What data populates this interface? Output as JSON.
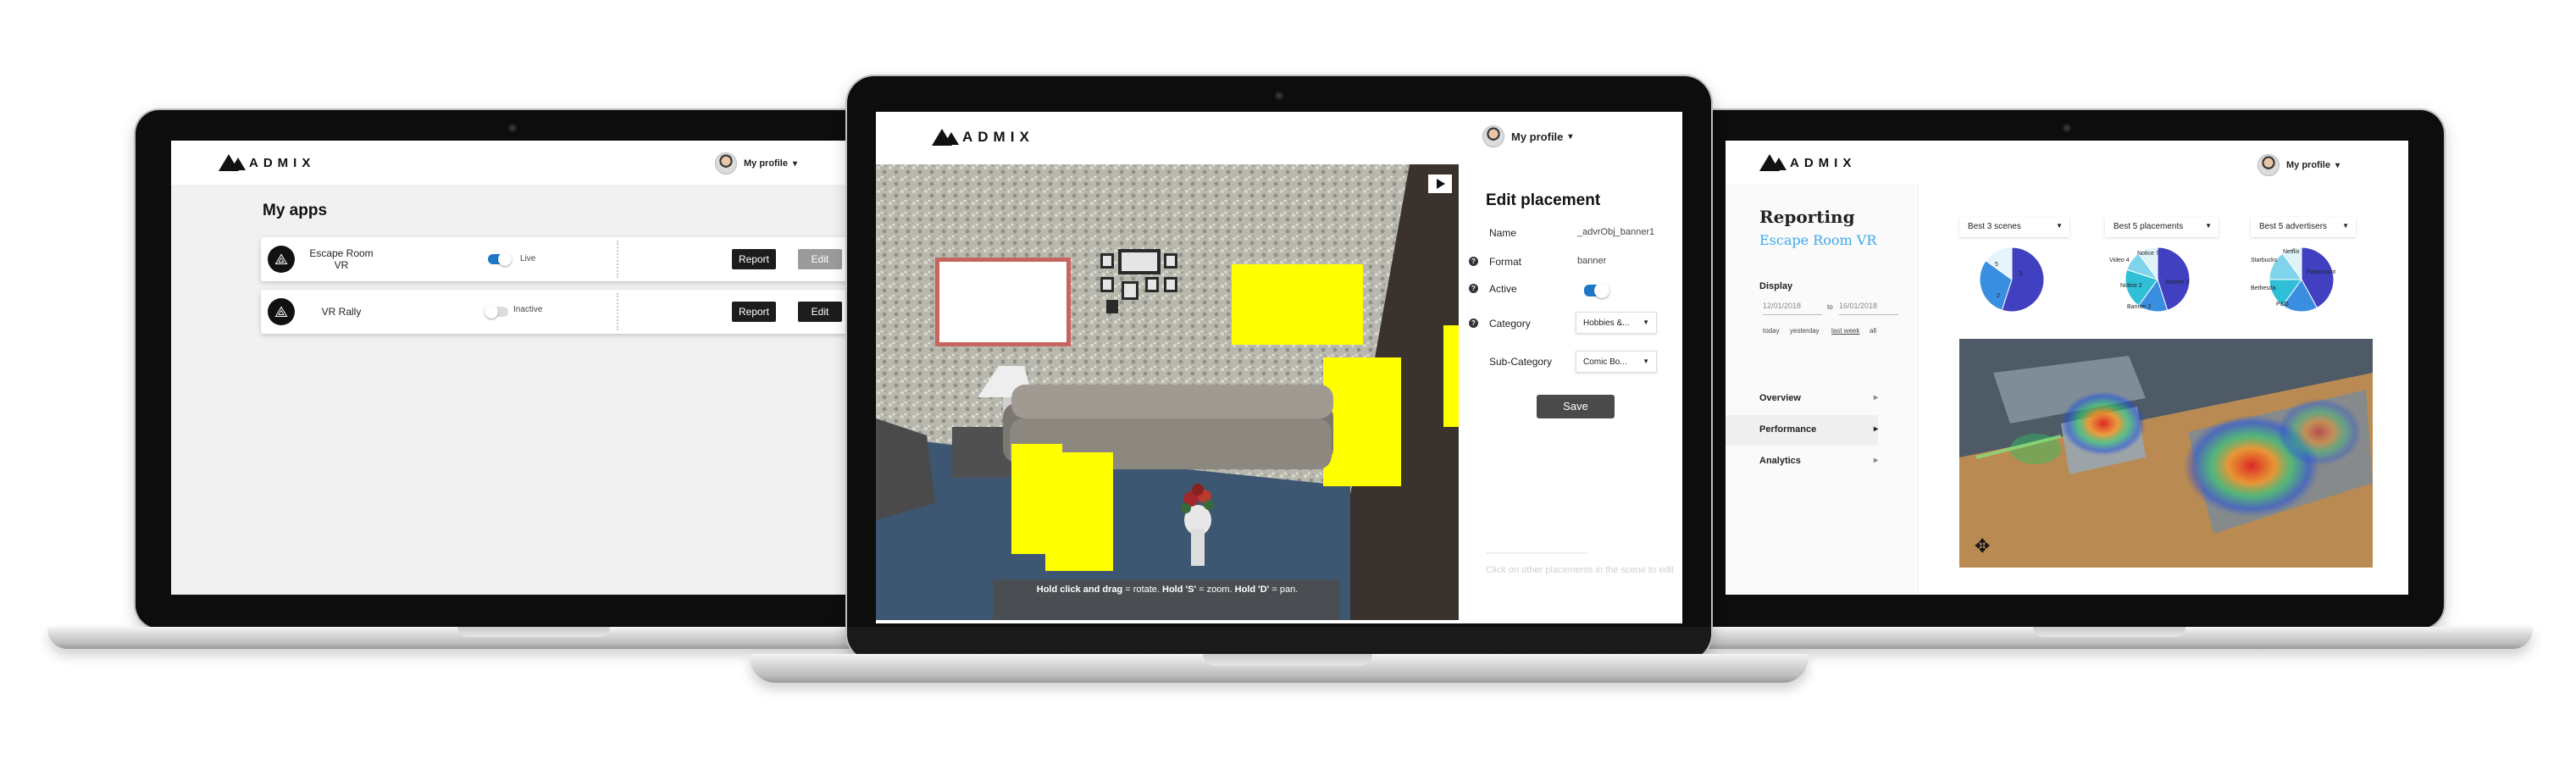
{
  "brand": {
    "name": "ADMIX"
  },
  "profile": {
    "label": "My profile",
    "caret": "▾"
  },
  "my_apps": {
    "title": "My apps",
    "apps": [
      {
        "name": "Escape Room VR",
        "status": "Live",
        "active": true,
        "report_label": "Report",
        "edit_label": "Edit",
        "edit_disabled": true
      },
      {
        "name": "VR Rally",
        "status": "Inactive",
        "active": false,
        "report_label": "Report",
        "edit_label": "Edit",
        "edit_disabled": false
      }
    ]
  },
  "editor": {
    "hint": "Hold click and drag = rotate. Hold 'S' = zoom. Hold 'D' = pan.",
    "hint_parts": [
      "Hold click and drag",
      " = rotate. ",
      "Hold 'S'",
      " = zoom. ",
      "Hold 'D'",
      " = pan."
    ],
    "panel": {
      "title": "Edit placement",
      "fields": {
        "name_label": "Name",
        "name_value": "_advrObj_banner1",
        "format_label": "Format",
        "format_value": "banner",
        "active_label": "Active",
        "category_label": "Category",
        "category_value": "Hobbies &...",
        "subcategory_label": "Sub-Category",
        "subcategory_value": "Comic Bo..."
      },
      "save_label": "Save",
      "footer_hint": "Click on other placements in the scene to edit"
    }
  },
  "reporting": {
    "title": "Reporting",
    "app_name": "Escape Room VR",
    "display_label": "Display",
    "date_from": "12/01/2018",
    "date_to_word": "to",
    "date_to": "16/01/2018",
    "quick_ranges": [
      "today",
      "yesterday",
      "last week",
      "all"
    ],
    "menu": [
      {
        "label": "Overview",
        "arrow": "▸"
      },
      {
        "label": "Performance",
        "arrow": "▸"
      },
      {
        "label": "Analytics",
        "arrow": "▸"
      }
    ],
    "charts": [
      {
        "selector": "Best 3 scenes",
        "pie_labels": [
          "5",
          "3",
          "2"
        ],
        "slices": [
          0.55,
          0.3,
          0.15
        ],
        "colors": [
          "#4040c0",
          "#3a8ee0",
          "#e6f4fb"
        ]
      },
      {
        "selector": "Best 5 placements",
        "pie_labels": [
          "Video 4",
          "Notice 7",
          "Notice 2",
          "Banner 2",
          "Screen 3"
        ],
        "slices": [
          0.45,
          0.15,
          0.2,
          0.1,
          0.1
        ],
        "colors": [
          "#4040c0",
          "#3a8ee0",
          "#2fc0d8",
          "#7fd4ec",
          "#dff3fa"
        ]
      },
      {
        "selector": "Best 5 advertisers",
        "pie_labels": [
          "Starbucks",
          "Netflix",
          "Bethesda",
          "P&G",
          "Paramount"
        ],
        "slices": [
          0.42,
          0.18,
          0.15,
          0.15,
          0.1
        ],
        "colors": [
          "#4040c0",
          "#3a8ee0",
          "#2fc0d8",
          "#7fd4ec",
          "#dff3fa"
        ]
      }
    ]
  }
}
